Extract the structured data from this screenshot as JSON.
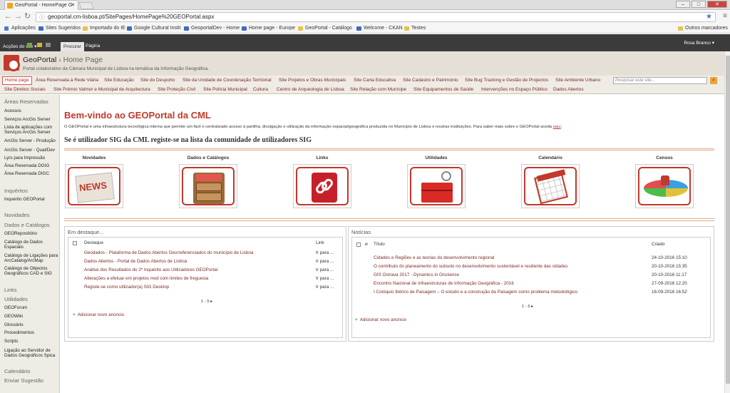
{
  "browser": {
    "tab_title": "GeoPortal - HomePage G",
    "url": "geoportal.cm-lisboa.pt/SitePages/HomePage%20GEOPortal.aspx",
    "bookmarks": [
      "Aplicações",
      "Sites Sugeridos",
      "Importado do IE",
      "Google Cultural Instit",
      "GeoportalDev - Home",
      "Home page - Europe",
      "GeoPortal - Catálogo",
      "Welcome - CKAN",
      "Testes",
      "Outros marcadores"
    ]
  },
  "ribbon": {
    "actions": "Acções do site ▾",
    "tab_browse": "Procurar",
    "tab_page": "Página",
    "user": "Rosa Branco ▾"
  },
  "header": {
    "site": "GeoPortal",
    "sep": " › ",
    "page": "Home Page",
    "subtitle": "Portal colaborativo da Câmara Municipal de Lisboa na temática da Informação Geográfica."
  },
  "nav": {
    "row1": [
      "Home page",
      "Área Reservada à Rede Viária",
      "Site Educação",
      "Site do Desporto",
      "Site da Unidade de Coordenação Territorial",
      "Site Projetos e Obras Municipais",
      "Site Carta Educativa",
      "Site Cadastro e Património",
      "Site Bug Tracking e Gestão de Projectos",
      "Site Ambiente Urbano"
    ],
    "row2": [
      "Site Direitos Sociais",
      "Site Prémio Valmor e Municipal de Arquitectura",
      "Site Proteção Civil",
      "Site Polícia Municipal",
      "Cultura",
      "Centro de Arqueologia de Lisboa",
      "Site Relação com Munícipe",
      "Site Equipamentos de Saúde",
      "Intervenções no Espaço Público",
      "Dados Abertos"
    ],
    "search_placeholder": "Pesquisar este site..."
  },
  "sidebar": {
    "areas_title": "Áreas Reservadas",
    "areas": [
      "Acessos",
      "Serviços ArcGis Server",
      "Lista de aplicações com Serviços ArcGis Server",
      "ArcGis Server - Produção",
      "ArcGis Server - Qual/Dev",
      "Lyrs para Impressão",
      "Área Reservada DGIG",
      "Área Reservada DIGC"
    ],
    "inq_title": "Inquéritos",
    "inq": [
      "Inquérito GEOPortal"
    ],
    "nov_title": "Novidades",
    "dados_title": "Dados e Catálogos",
    "dados": [
      "GEORepositório",
      "Catálogo de Dados Espaciais",
      "Catálogo de Ligações para ArcCatalog/ArcMap",
      "Catálogo de Objectos Geográficos CAD e SIG"
    ],
    "links_title": "Links",
    "util_title": "Utilidades",
    "util": [
      "GEOForum",
      "GEOWiki",
      "Glossário",
      "Procedimentos",
      "Scripts",
      "Ligação ao Servidor de Dados Geográficos Spica"
    ],
    "cal_title": "Calendário",
    "sug_title": "Enviar Sugestão"
  },
  "main": {
    "welcome": "Bem-vindo ao GEOPortal da CML",
    "description": "O GEOPortal é uma infraestrutura tecnológica interna que permite um fácil e centralizado acesso à partilha, divulgação e utilização da informação espacial/geográfica produzida no Município de Lisboa e noutras instituições. Para saber mais sobre o GEOPortal aceda",
    "desc_link": "aqui",
    "register": "Se é utilizador SIG da CML registe-se na lista da comunidade de utilizadores SIG",
    "tiles": [
      "Novidades",
      "Dados e Catálogos",
      "Links",
      "Utilidades",
      "Calendário",
      "Censos"
    ],
    "news_word": "NEWS"
  },
  "destaque": {
    "title": "Em destaque...",
    "col_title": "Destaque",
    "col_link": "Link",
    "items": [
      {
        "title": "Geodados - Plataforma de Dados Abertos Georreferenciados do município de Lisboa",
        "link": "Ir para ..."
      },
      {
        "title": "Dados Abertos - Portal de Dados Abertos de Lisboa",
        "link": "Ir para ..."
      },
      {
        "title": "Análise dos Resultados do 2º Inquérito aos Utilizadores GEOPortal",
        "link": "Ir para ..."
      },
      {
        "title": "Alterações a efetuar em projetos mxd com limites de freguesia",
        "link": "Ir para ..."
      },
      {
        "title": "Registe-se como utilizador(a) SIG Desktop",
        "link": "Ir para ..."
      }
    ],
    "pager": "1 - 5",
    "add": "Adicionar novo anúncio"
  },
  "noticias": {
    "title": "Notícias",
    "col_title": "Título",
    "col_created": "Criado",
    "items": [
      {
        "title": "Cidades e Regiões e as teorias do desenvolvimento regional",
        "date": "24-10-2016 15:10"
      },
      {
        "title": "O contributo do planeamento do subsolo no desenvolvimento sustentável e resiliente das cidades",
        "date": "20-10-2016 15:35"
      },
      {
        "title": "GIS Ostrava 2017 - Dynamics in GIscience",
        "date": "20-10-2016 11:17"
      },
      {
        "title": "Encontro Nacional de Infraestruturas de Informação Geográfica - 2016",
        "date": "27-09-2016 12:20"
      },
      {
        "title": "I Colóquio Ibérico de Paisagem – O estudo e a construção da Paisagem como problema metodológico",
        "date": "16-09-2016 16:52"
      }
    ],
    "pager": "1 - 5",
    "add": "Adicionar novo anúncio"
  }
}
